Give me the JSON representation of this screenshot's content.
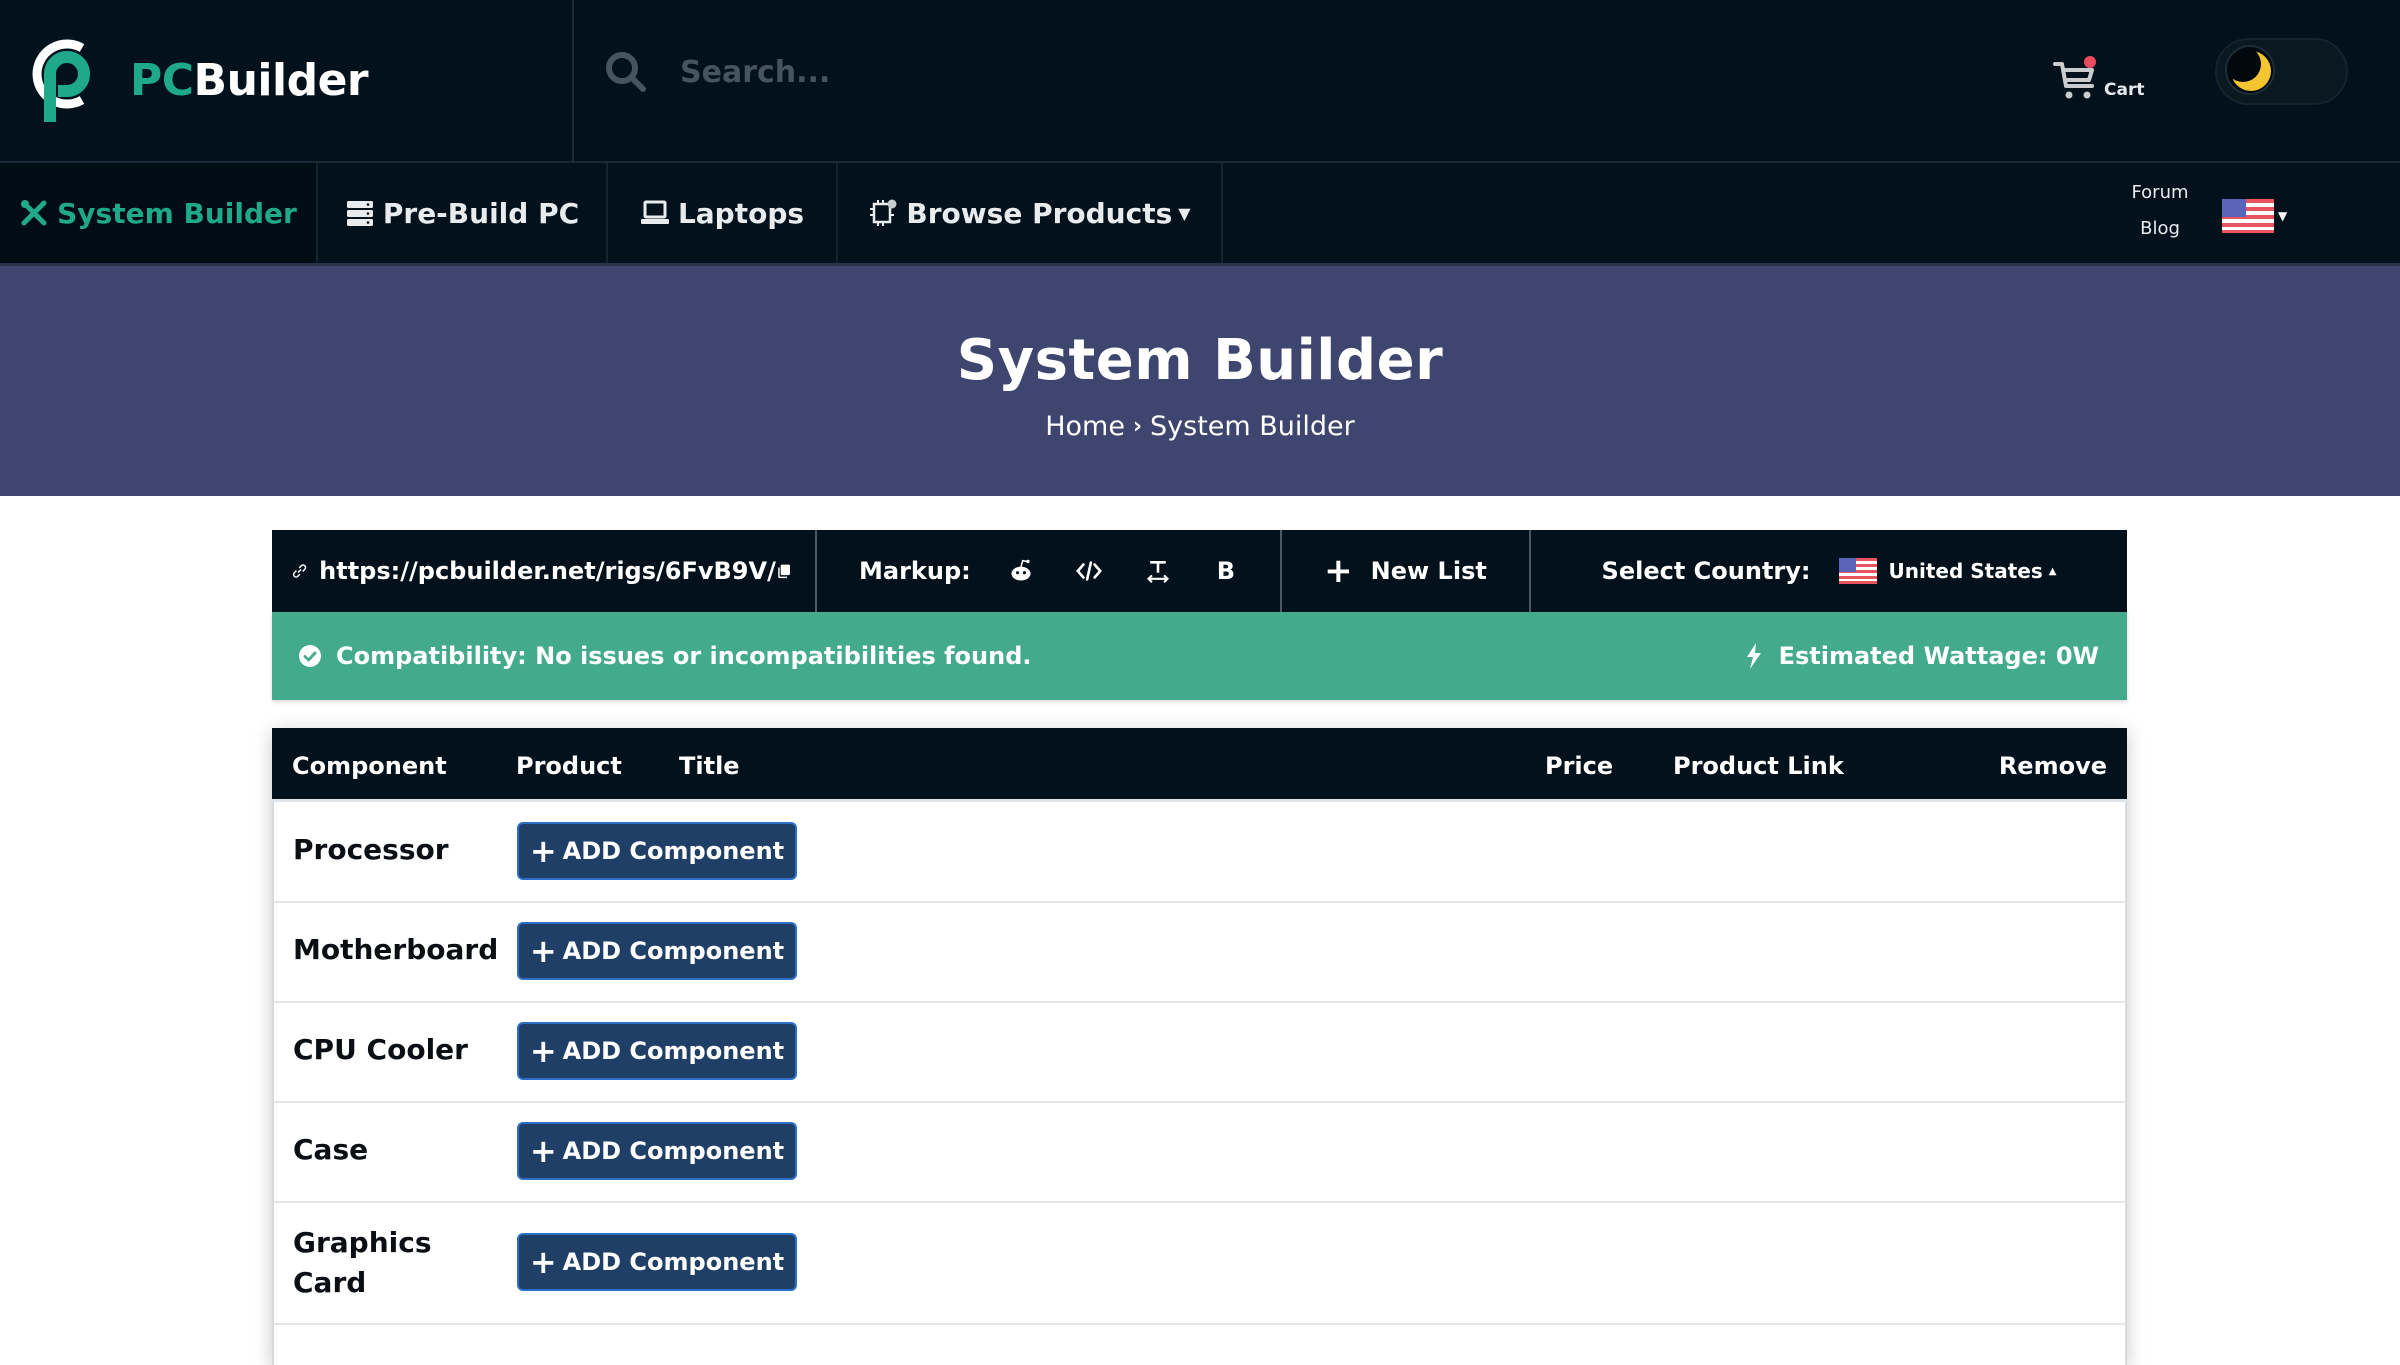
{
  "brand": {
    "prefix": "PC",
    "suffix": "Builder"
  },
  "search": {
    "placeholder": "Search...",
    "value": ""
  },
  "cart": {
    "label": "Cart",
    "has_badge": true
  },
  "theme": {
    "mode": "dark"
  },
  "nav": {
    "items": [
      {
        "label": "System Builder",
        "icon": "tools-icon",
        "active": true
      },
      {
        "label": "Pre-Build PC",
        "icon": "server-icon",
        "active": false
      },
      {
        "label": "Laptops",
        "icon": "laptop-icon",
        "active": false
      },
      {
        "label": "Browse Products",
        "icon": "chip-icon",
        "active": false,
        "dropdown": true
      }
    ],
    "right_links": [
      "Forum",
      "Blog"
    ],
    "language": "United States"
  },
  "hero": {
    "title": "System Builder",
    "breadcrumb": [
      "Home",
      "System Builder"
    ]
  },
  "toolbar": {
    "share_url": "https://pcbuilder.net/rigs/6FvB9V/",
    "markup_label": "Markup:",
    "markup_options": [
      "reddit",
      "html",
      "text",
      "bbcode"
    ],
    "bbcode_glyph": "B",
    "new_list_label": "New List",
    "country_label": "Select Country:",
    "country_value": "United States"
  },
  "compatibility": {
    "message": "Compatibility: No issues or incompatibilities found.",
    "wattage": "Estimated Wattage: 0W",
    "status_color": "#43aa8b"
  },
  "table": {
    "columns": [
      "Component",
      "Product",
      "Title",
      "Price",
      "Product Link",
      "Remove"
    ],
    "add_label": "ADD Component",
    "rows": [
      {
        "component": "Processor"
      },
      {
        "component": "Motherboard"
      },
      {
        "component": "CPU Cooler"
      },
      {
        "component": "Case"
      },
      {
        "component": "Graphics Card"
      }
    ]
  },
  "colors": {
    "dark_bg": "#02111b",
    "accent": "#1fa98a",
    "hero_bg": "#3e456e",
    "button_bg": "#1f3f66"
  }
}
